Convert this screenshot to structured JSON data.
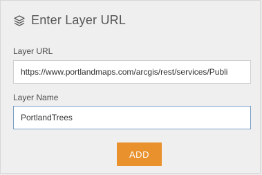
{
  "header": {
    "title": "Enter Layer URL",
    "icon": "layers-icon"
  },
  "form": {
    "url_label": "Layer URL",
    "url_value": "https://www.portlandmaps.com/arcgis/rest/services/Publi",
    "name_label": "Layer Name",
    "name_value": "PortlandTrees"
  },
  "actions": {
    "add_label": "ADD",
    "add_color": "#e8912d"
  }
}
